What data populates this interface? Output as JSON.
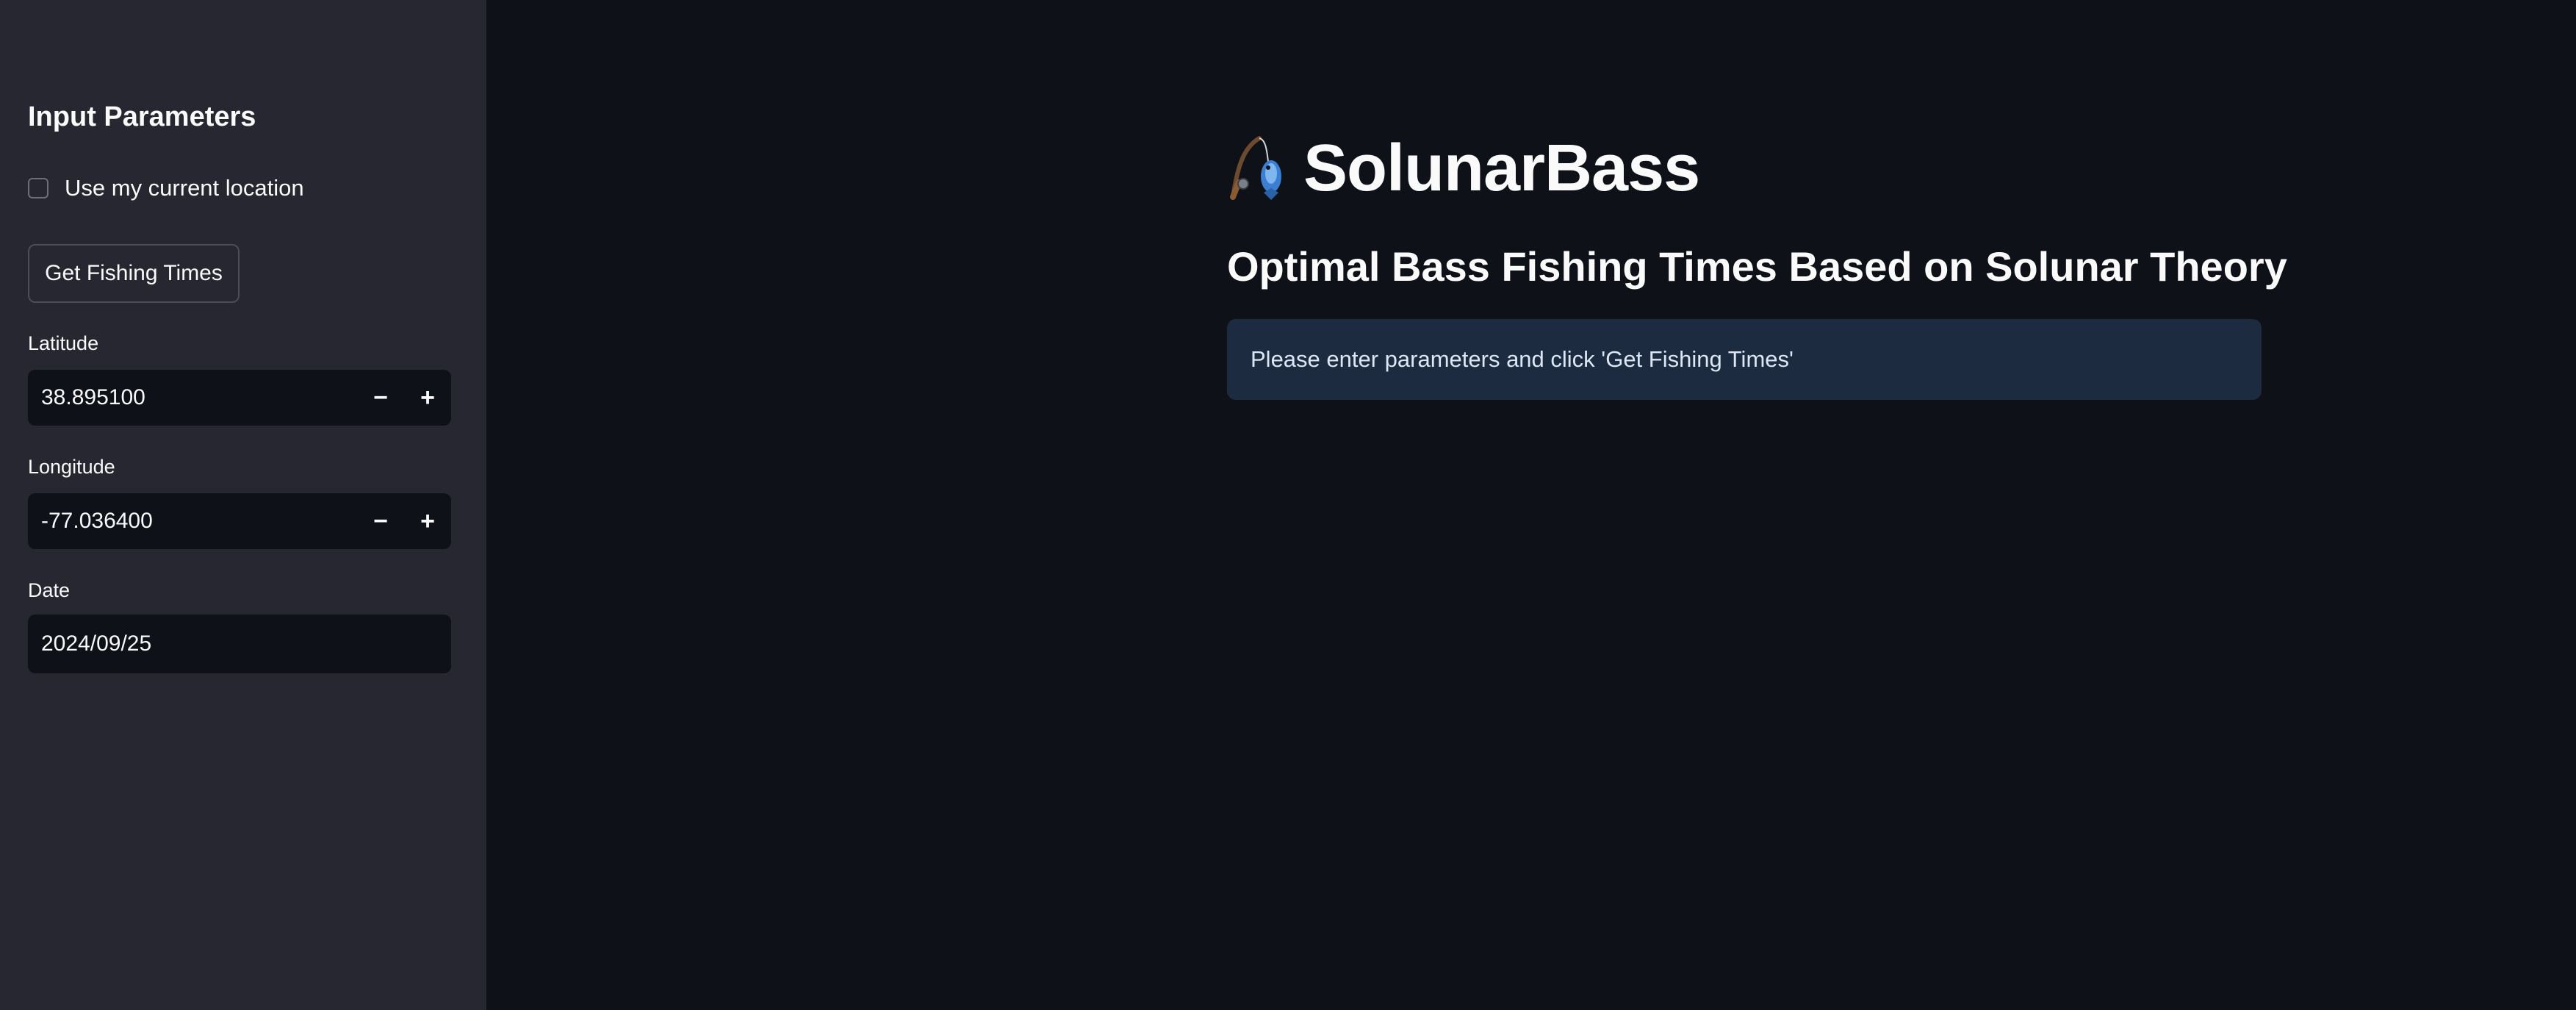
{
  "sidebar": {
    "title": "Input Parameters",
    "use_location_label": "Use my current location",
    "use_location_checked": false,
    "get_button_label": "Get Fishing Times",
    "latitude": {
      "label": "Latitude",
      "value": "38.895100"
    },
    "longitude": {
      "label": "Longitude",
      "value": "-77.036400"
    },
    "date": {
      "label": "Date",
      "value": "2024/09/25"
    },
    "stepper": {
      "minus": "−",
      "plus": "+"
    }
  },
  "main": {
    "title_icon": "fishing-pole-fish-icon",
    "title": "SolunarBass",
    "subtitle": "Optimal Bass Fishing Times Based on Solunar Theory",
    "info_message": "Please enter parameters and click 'Get Fishing Times'"
  },
  "colors": {
    "background": "#0e1117",
    "sidebar": "#262730",
    "info_box": "#1c2b40",
    "text": "#fafafa"
  }
}
